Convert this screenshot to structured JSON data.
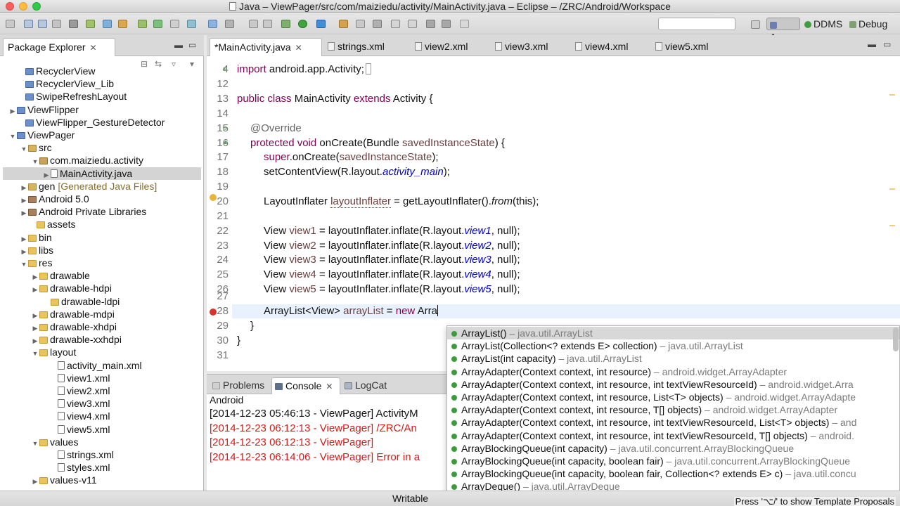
{
  "window": {
    "title": "Java – ViewPager/src/com/maiziedu/activity/MainActivity.java – Eclipse – /ZRC/Android/Workspace"
  },
  "perspectives": {
    "java": "Java",
    "ddms": "DDMS",
    "debug": "Debug"
  },
  "package_explorer": {
    "title": "Package Explorer",
    "tree": [
      {
        "label": "RecyclerView",
        "note": "",
        "icon": "project-icon",
        "arrow": ""
      },
      {
        "label": "RecyclerView_Lib",
        "note": "",
        "icon": "project-icon",
        "arrow": ""
      },
      {
        "label": "SwipeRefreshLayout",
        "note": "",
        "icon": "project-icon",
        "arrow": ""
      },
      {
        "label": "ViewFlipper",
        "note": "",
        "icon": "project-icon",
        "arrow": "▶"
      },
      {
        "label": "ViewFlipper_GestureDetector",
        "note": "",
        "icon": "project-icon",
        "arrow": ""
      },
      {
        "label": "ViewPager",
        "note": "",
        "icon": "project-icon",
        "arrow": "▼"
      },
      {
        "label": "src",
        "note": "",
        "icon": "src-folder-icon",
        "arrow": "▼"
      },
      {
        "label": "com.maiziedu.activity",
        "note": "",
        "icon": "package-icon",
        "arrow": "▼"
      },
      {
        "label": "MainActivity.java",
        "note": "",
        "icon": "java-file-icon",
        "arrow": "▶"
      },
      {
        "label": "gen",
        "note": "[Generated Java Files]",
        "icon": "gen-folder-icon",
        "arrow": "▶"
      },
      {
        "label": "Android 5.0",
        "note": "",
        "icon": "library-icon",
        "arrow": "▶"
      },
      {
        "label": "Android Private Libraries",
        "note": "",
        "icon": "library-icon",
        "arrow": "▶"
      },
      {
        "label": "assets",
        "note": "",
        "icon": "folder-icon",
        "arrow": ""
      },
      {
        "label": "bin",
        "note": "",
        "icon": "folder-icon",
        "arrow": "▶"
      },
      {
        "label": "libs",
        "note": "",
        "icon": "folder-icon",
        "arrow": "▶"
      },
      {
        "label": "res",
        "note": "",
        "icon": "folder-icon",
        "arrow": "▼"
      },
      {
        "label": "drawable",
        "note": "",
        "icon": "folder-icon",
        "arrow": "▶"
      },
      {
        "label": "drawable-hdpi",
        "note": "",
        "icon": "folder-icon",
        "arrow": "▶"
      },
      {
        "label": "drawable-ldpi",
        "note": "",
        "icon": "folder-icon",
        "arrow": ""
      },
      {
        "label": "drawable-mdpi",
        "note": "",
        "icon": "folder-icon",
        "arrow": "▶"
      },
      {
        "label": "drawable-xhdpi",
        "note": "",
        "icon": "folder-icon",
        "arrow": "▶"
      },
      {
        "label": "drawable-xxhdpi",
        "note": "",
        "icon": "folder-icon",
        "arrow": "▶"
      },
      {
        "label": "layout",
        "note": "",
        "icon": "folder-icon",
        "arrow": "▼"
      },
      {
        "label": "activity_main.xml",
        "note": "",
        "icon": "xml-file-icon",
        "arrow": ""
      },
      {
        "label": "view1.xml",
        "note": "",
        "icon": "xml-file-icon",
        "arrow": ""
      },
      {
        "label": "view2.xml",
        "note": "",
        "icon": "xml-file-icon",
        "arrow": ""
      },
      {
        "label": "view3.xml",
        "note": "",
        "icon": "xml-file-icon",
        "arrow": ""
      },
      {
        "label": "view4.xml",
        "note": "",
        "icon": "xml-file-icon",
        "arrow": ""
      },
      {
        "label": "view5.xml",
        "note": "",
        "icon": "xml-file-icon",
        "arrow": ""
      },
      {
        "label": "values",
        "note": "",
        "icon": "folder-icon",
        "arrow": "▼"
      },
      {
        "label": "strings.xml",
        "note": "",
        "icon": "xml-file-icon",
        "arrow": ""
      },
      {
        "label": "styles.xml",
        "note": "",
        "icon": "xml-file-icon",
        "arrow": ""
      },
      {
        "label": "values-v11",
        "note": "",
        "icon": "folder-icon",
        "arrow": "▶"
      }
    ]
  },
  "editor": {
    "tabs": [
      {
        "label": "*MainActivity.java"
      },
      {
        "label": "strings.xml"
      },
      {
        "label": "view2.xml"
      },
      {
        "label": "view3.xml"
      },
      {
        "label": "view4.xml"
      },
      {
        "label": "view5.xml"
      }
    ],
    "line_numbers": [
      "4",
      "12",
      "13",
      "14",
      "15",
      "16",
      "17",
      "18",
      "19",
      "20",
      "21",
      "22",
      "23",
      "24",
      "25",
      "26",
      "27",
      "28",
      "29",
      "30",
      "31"
    ],
    "code": {
      "l4": {
        "kw": "import",
        "rest": " android.app.Activity;"
      },
      "l13": {
        "kw1": "public class",
        "name": " MainActivity ",
        "kw2": "extends",
        "rest": " Activity {"
      },
      "l15": "@Override",
      "l16": {
        "kw": "protected void",
        "rest": " onCreate(Bundle ",
        "param": "savedInstanceState",
        "end": ") {"
      },
      "l17": {
        "kw": "super",
        "rest": ".onCreate(",
        "param": "savedInstanceState",
        "end": ");"
      },
      "l18": {
        "rest": "setContentView(R.layout.",
        "fld": "activity_main",
        "end": ");"
      },
      "l20": {
        "type": "LayoutInflater ",
        "var": "layoutInflater",
        "mid": " = getLayoutInflater().",
        "fld": "from",
        "end": "(this);"
      },
      "views": [
        {
          "type": "View ",
          "var": "view1",
          "mid": " = layoutInflater.inflate(R.layout.",
          "fld": "view1",
          "end": ", null);"
        },
        {
          "type": "View ",
          "var": "view2",
          "mid": " = layoutInflater.inflate(R.layout.",
          "fld": "view2",
          "end": ", null);"
        },
        {
          "type": "View ",
          "var": "view3",
          "mid": " = layoutInflater.inflate(R.layout.",
          "fld": "view3",
          "end": ", null);"
        },
        {
          "type": "View ",
          "var": "view4",
          "mid": " = layoutInflater.inflate(R.layout.",
          "fld": "view4",
          "end": ", null);"
        },
        {
          "type": "View ",
          "var": "view5",
          "mid": " = layoutInflater.inflate(R.layout.",
          "fld": "view5",
          "end": ", null);"
        }
      ],
      "l28": {
        "type": "ArrayList<View>",
        "var": " arrayList",
        "mid": " = ",
        "kw": "new",
        "end": " Arra"
      },
      "l29": "}",
      "l30": "}"
    }
  },
  "autocomplete": {
    "items": [
      {
        "sig": "ArrayList()",
        "pkg": " – java.util.ArrayList"
      },
      {
        "sig": "ArrayList(Collection<? extends E> collection)",
        "pkg": " – java.util.ArrayList"
      },
      {
        "sig": "ArrayList(int capacity)",
        "pkg": " – java.util.ArrayList"
      },
      {
        "sig": "ArrayAdapter(Context context, int resource)",
        "pkg": " – android.widget.ArrayAdapter"
      },
      {
        "sig": "ArrayAdapter(Context context, int resource, int textViewResourceId)",
        "pkg": " – android.widget.Arra"
      },
      {
        "sig": "ArrayAdapter(Context context, int resource, List<T> objects)",
        "pkg": " – android.widget.ArrayAdapte"
      },
      {
        "sig": "ArrayAdapter(Context context, int resource, T[] objects)",
        "pkg": " – android.widget.ArrayAdapter"
      },
      {
        "sig": "ArrayAdapter(Context context, int resource, int textViewResourceId, List<T> objects)",
        "pkg": " – and"
      },
      {
        "sig": "ArrayAdapter(Context context, int resource, int textViewResourceId, T[] objects)",
        "pkg": " – android."
      },
      {
        "sig": "ArrayBlockingQueue(int capacity)",
        "pkg": " – java.util.concurrent.ArrayBlockingQueue"
      },
      {
        "sig": "ArrayBlockingQueue(int capacity, boolean fair)",
        "pkg": " – java.util.concurrent.ArrayBlockingQueue"
      },
      {
        "sig": "ArrayBlockingQueue(int capacity, boolean fair, Collection<? extends E> c)",
        "pkg": " – java.util.concu"
      },
      {
        "sig": "ArrayDeque()",
        "pkg": " – java.util.ArrayDeque"
      }
    ],
    "hint": "Press '⌥/' to show Template Proposals"
  },
  "console": {
    "tabs": [
      {
        "label": "Problems"
      },
      {
        "label": "Console"
      },
      {
        "label": "LogCat"
      }
    ],
    "title": "Android",
    "lines": [
      {
        "text": "[2014-12-23 05:46:13 - ViewPager] ActivityM",
        "kind": "black"
      },
      {
        "text": "[2014-12-23 06:12:13 - ViewPager] /ZRC/An",
        "kind": "red"
      },
      {
        "text": "[2014-12-23 06:12:13 - ViewPager]",
        "kind": "red"
      },
      {
        "text": "[2014-12-23 06:14:06 - ViewPager] Error in a",
        "kind": "red"
      }
    ]
  },
  "status_bar": {
    "writable": "Writable"
  },
  "colors": {
    "keyword": "#7f0055",
    "field": "#0000c0",
    "console_error": "#d21b1b",
    "selection": "#d4d4d4"
  }
}
